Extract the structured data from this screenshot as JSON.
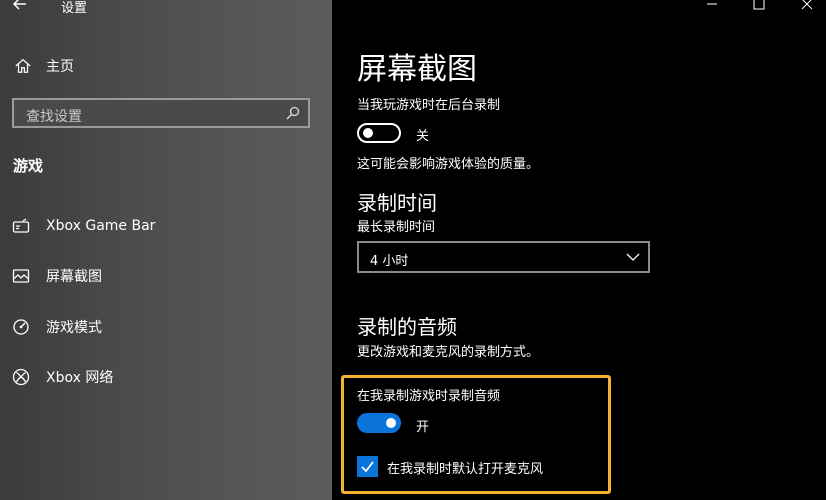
{
  "window": {
    "title": "设置",
    "controls": [
      "minimize-icon",
      "maximize-icon",
      "close-icon"
    ]
  },
  "sidebar": {
    "home_label": "主页",
    "search_placeholder": "查找设置",
    "section_title": "游戏",
    "items": [
      {
        "label": "Xbox Game Bar",
        "icon": "game-bar-icon"
      },
      {
        "label": "屏幕截图",
        "icon": "captures-icon"
      },
      {
        "label": "游戏模式",
        "icon": "game-mode-icon"
      },
      {
        "label": "Xbox 网络",
        "icon": "xbox-icon"
      }
    ]
  },
  "main": {
    "title": "屏幕截图",
    "background_record": {
      "label": "当我玩游戏时在后台录制",
      "toggle_state": "关",
      "is_on": false,
      "note": "这可能会影响游戏体验的质量。"
    },
    "record_time": {
      "heading": "录制时间",
      "label": "最长录制时间",
      "selected": "4 小时"
    },
    "audio": {
      "heading": "录制的音频",
      "description": "更改游戏和麦克风的录制方式。",
      "record_audio_label": "在我录制游戏时录制音频",
      "toggle_state": "开",
      "is_on": true,
      "mic_checkbox_label": "在我录制时默认打开麦克风",
      "mic_checked": true
    }
  },
  "colors": {
    "accent": "#0a74d9",
    "highlight": "#f4b22e",
    "content_bg": "#000000"
  }
}
